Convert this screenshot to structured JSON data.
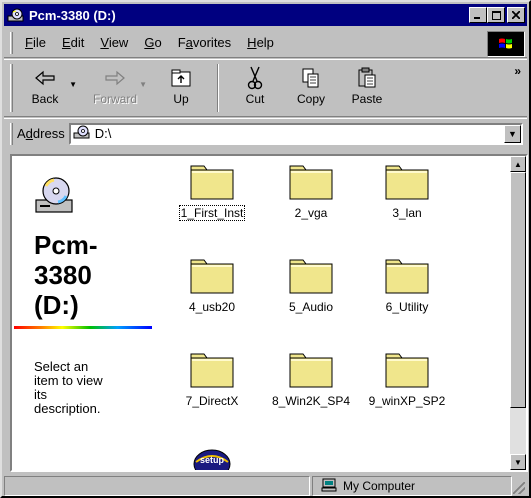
{
  "window": {
    "title": "Pcm-3380 (D:)",
    "controls": [
      "_",
      "□",
      "×"
    ]
  },
  "menu": [
    {
      "prefix": "",
      "u": "F",
      "rest": "ile"
    },
    {
      "prefix": "",
      "u": "E",
      "rest": "dit"
    },
    {
      "prefix": "",
      "u": "V",
      "rest": "iew"
    },
    {
      "prefix": "",
      "u": "G",
      "rest": "o"
    },
    {
      "prefix": "F",
      "u": "a",
      "rest": "vorites"
    },
    {
      "prefix": "",
      "u": "H",
      "rest": "elp"
    }
  ],
  "toolbar": {
    "back": "Back",
    "forward": "Forward",
    "up": "Up",
    "cut": "Cut",
    "copy": "Copy",
    "paste": "Paste",
    "more": "»"
  },
  "address": {
    "label_prefix": "A",
    "label_underlined": "d",
    "label_rest": "dress",
    "value": "D:\\"
  },
  "leftpane": {
    "title_line1": "Pcm-",
    "title_line2": "3380",
    "title_line3": "(D:)",
    "desc_line1": "Select an",
    "desc_line2": "item to view",
    "desc_line3": "its",
    "desc_line4": "description."
  },
  "folders": [
    {
      "name": "1_First_Inst"
    },
    {
      "name": "2_vga"
    },
    {
      "name": "3_lan"
    },
    {
      "name": "4_usb20"
    },
    {
      "name": "5_Audio"
    },
    {
      "name": "6_Utility"
    },
    {
      "name": "7_DirectX"
    },
    {
      "name": "8_Win2K_SP4"
    },
    {
      "name": "9_winXP_SP2"
    }
  ],
  "setup_item": {
    "badge": "setup"
  },
  "statusbar": {
    "location": "My Computer"
  },
  "colors": {
    "titlebar": "#000080",
    "folder": "#f0e68c",
    "face": "#c0c0c0"
  }
}
